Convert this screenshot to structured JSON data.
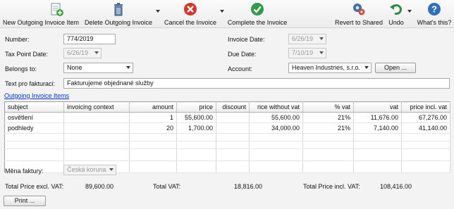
{
  "toolbar": {
    "new_label": "New",
    "new_outgoing_label": "Outgoing Invoice Item",
    "delete_label": "Delete Outgoing Invoice",
    "cancel_label": "Cancel the Invoice",
    "complete_label": "Complete the Invoice",
    "revert_label": "Revert to Shared",
    "undo_label": "Undo",
    "help_label": "What's this?"
  },
  "form": {
    "number_label": "Number:",
    "number_value": "774/2019",
    "invoice_date_label": "Invoice Date:",
    "invoice_date_value": "6/26/19",
    "tax_point_label": "Tax Point Date:",
    "tax_point_value": "6/26/19",
    "due_date_label": "Due Date:",
    "due_date_value": "7/10/19",
    "belongs_label": "Belongs to:",
    "belongs_value": "None",
    "account_label": "Account:",
    "account_value": "Heaven Industries, s.r.o.",
    "open_button": "Open ...",
    "text_label": "Text pro fakturaci:",
    "text_value": "Fakturujeme objednané služby"
  },
  "items_link": "Outgoing Invoice Items",
  "table": {
    "columns": [
      "subject",
      "invoicing context",
      "amount",
      "price",
      "discount",
      "rice without vat",
      "% vat",
      "vat",
      "price incl. vat"
    ],
    "rows": [
      [
        "osvětlení",
        "",
        "1",
        "55,600.00",
        "",
        "55,600.00",
        "21%",
        "11,676.00",
        "67,276.00"
      ],
      [
        "podhledy",
        "",
        "20",
        "1,700.00",
        "",
        "34,000.00",
        "21%",
        "7,140.00",
        "41,140.00"
      ]
    ]
  },
  "currency": {
    "label": "Měna faktury:",
    "value": "Česká koruna"
  },
  "totals": {
    "excl_label": "Total Price excl. VAT:",
    "excl_value": "89,600.00",
    "vat_label": "Total VAT:",
    "vat_value": "18,816.00",
    "incl_label": "Total Price incl. VAT:",
    "incl_value": "108,416.00"
  },
  "print_button": "Print ..."
}
